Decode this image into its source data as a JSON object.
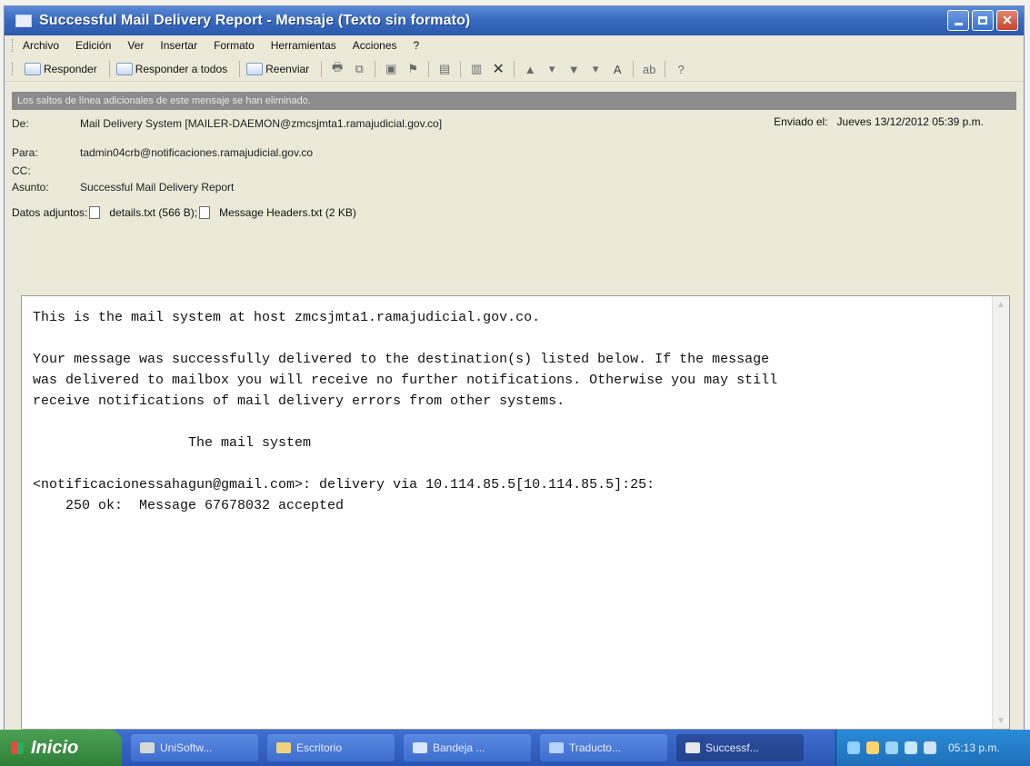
{
  "window": {
    "title": "Successful Mail Delivery Report - Mensaje (Texto sin formato)"
  },
  "menu": {
    "items": [
      "Archivo",
      "Edición",
      "Ver",
      "Insertar",
      "Formato",
      "Herramientas",
      "Acciones",
      "?"
    ]
  },
  "toolbar": {
    "reply": "Responder",
    "reply_all": "Responder a todos",
    "forward": "Reenviar"
  },
  "infobar": {
    "text": "Los saltos de línea adicionales de este mensaje se han eliminado."
  },
  "header": {
    "from_label": "De:",
    "from_value": "Mail Delivery System [MAILER-DAEMON@zmcsjmta1.ramajudicial.gov.co]",
    "sent_label": "Enviado el:",
    "sent_value": "Jueves 13/12/2012 05:39 p.m.",
    "to_label": "Para:",
    "to_value": "tadmin04crb@notificaciones.ramajudicial.gov.co",
    "cc_label": "CC:",
    "subject_label": "Asunto:",
    "subject_value": "Successful Mail Delivery Report",
    "attachments_label": "Datos adjuntos:",
    "attachment_1": "details.txt (566 B);",
    "attachment_2": "Message Headers.txt (2 KB)"
  },
  "body": {
    "text": "This is the mail system at host zmcsjmta1.ramajudicial.gov.co.\n\nYour message was successfully delivered to the destination(s) listed below. If the message\nwas delivered to mailbox you will receive no further notifications. Otherwise you may still\nreceive notifications of mail delivery errors from other systems.\n\n                   The mail system\n\n<notificacionessahagun@gmail.com>: delivery via 10.114.85.5[10.114.85.5]:25:\n    250 ok:  Message 67678032 accepted"
  },
  "taskbar": {
    "start": "Inicio",
    "tasks": [
      "UniSoftw...",
      "Escritorio",
      "Bandeja ...",
      "Traducto...",
      "Successf..."
    ],
    "time": "05:13 p.m."
  }
}
